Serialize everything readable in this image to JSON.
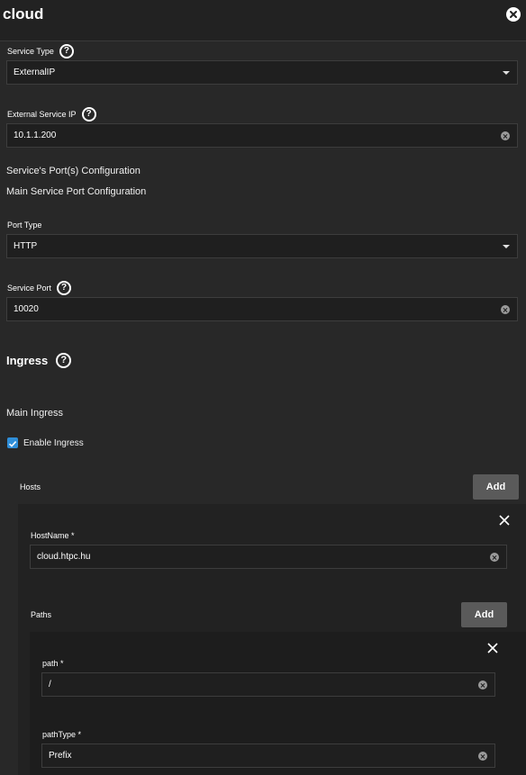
{
  "header": {
    "title": "cloud"
  },
  "service_type": {
    "label": "Service Type",
    "value": "ExternalIP"
  },
  "external_ip": {
    "label": "External Service IP",
    "value": "10.1.1.200"
  },
  "ports_config": {
    "heading": "Service's Port(s) Configuration",
    "subheading": "Main Service Port Configuration"
  },
  "port_type": {
    "label": "Port Type",
    "value": "HTTP"
  },
  "service_port": {
    "label": "Service Port",
    "value": "10020"
  },
  "ingress": {
    "heading": "Ingress",
    "main_label": "Main Ingress",
    "enable_label": "Enable Ingress",
    "enabled": true
  },
  "hosts": {
    "label": "Hosts",
    "add_label": "Add",
    "hostname_label": "HostName *",
    "hostname_value": "cloud.htpc.hu"
  },
  "paths": {
    "label": "Paths",
    "add_label": "Add",
    "path_label": "path *",
    "path_value": "/",
    "path_type_label": "pathType *",
    "path_type_value": "Prefix"
  }
}
